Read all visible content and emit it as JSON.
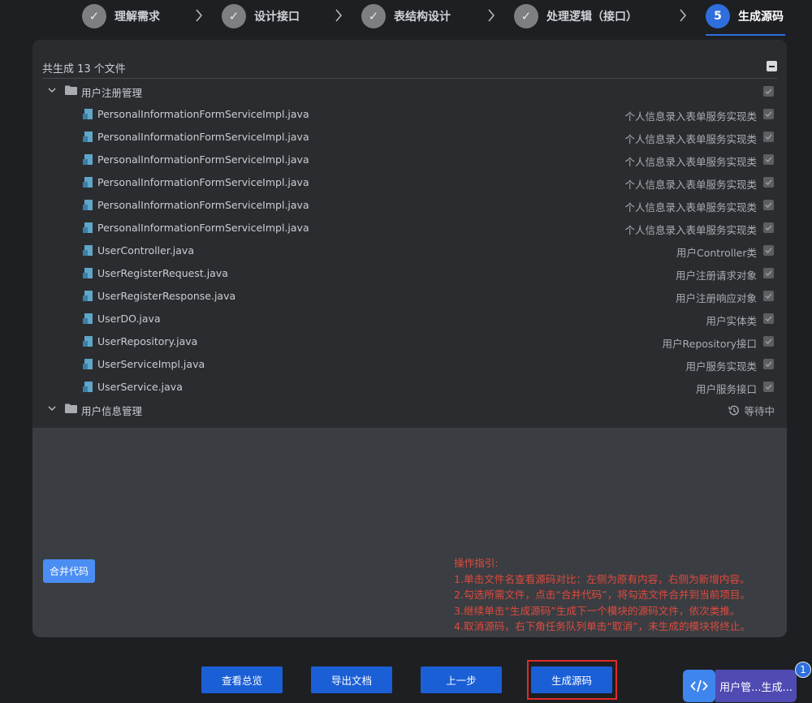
{
  "stepper": {
    "steps": [
      {
        "label": "理解需求",
        "marker": "✓"
      },
      {
        "label": "设计接口",
        "marker": "✓"
      },
      {
        "label": "表结构设计",
        "marker": "✓"
      },
      {
        "label": "处理逻辑（接口）",
        "marker": "✓"
      },
      {
        "label": "生成源码",
        "marker": "5"
      }
    ]
  },
  "summary": "共生成 13 个文件",
  "folders": [
    {
      "name": "用户注册管理",
      "files": [
        {
          "name": "PersonalInformationFormServiceImpl.java",
          "desc": "个人信息录入表单服务实现类"
        },
        {
          "name": "PersonalInformationFormServiceImpl.java",
          "desc": "个人信息录入表单服务实现类"
        },
        {
          "name": "PersonalInformationFormServiceImpl.java",
          "desc": "个人信息录入表单服务实现类"
        },
        {
          "name": "PersonalInformationFormServiceImpl.java",
          "desc": "个人信息录入表单服务实现类"
        },
        {
          "name": "PersonalInformationFormServiceImpl.java",
          "desc": "个人信息录入表单服务实现类"
        },
        {
          "name": "PersonalInformationFormServiceImpl.java",
          "desc": "个人信息录入表单服务实现类"
        },
        {
          "name": "UserController.java",
          "desc": "用户Controller类"
        },
        {
          "name": "UserRegisterRequest.java",
          "desc": "用户注册请求对象"
        },
        {
          "name": "UserRegisterResponse.java",
          "desc": "用户注册响应对象"
        },
        {
          "name": "UserDO.java",
          "desc": "用户实体类"
        },
        {
          "name": "UserRepository.java",
          "desc": "用户Repository接口"
        },
        {
          "name": "UserServiceImpl.java",
          "desc": "用户服务实现类"
        },
        {
          "name": "UserService.java",
          "desc": "用户服务接口"
        }
      ]
    },
    {
      "name": "用户信息管理",
      "status": "等待中"
    }
  ],
  "merge_button": "合并代码",
  "guide": {
    "title": "操作指引:",
    "lines": [
      "1.单击文件名查看源码对比：左侧为原有内容，右侧为新增内容。",
      "2.勾选所需文件，点击“合并代码”，将勾选文件合并到当前项目。",
      "3.继续单击“生成源码”生成下一个模块的源码文件，依次类推。",
      "4.取消源码，右下角任务队列单击“取消”，未生成的模块将终止。"
    ]
  },
  "bottom_buttons": {
    "overview": "查看总览",
    "export": "导出文档",
    "prev": "上一步",
    "generate": "生成源码"
  },
  "task_float": {
    "label": "用户管...生成...",
    "badge": "1"
  },
  "colors": {
    "accent": "#2f6fdd",
    "guide_text": "#e04a3f",
    "highlight": "#e02a2a"
  }
}
